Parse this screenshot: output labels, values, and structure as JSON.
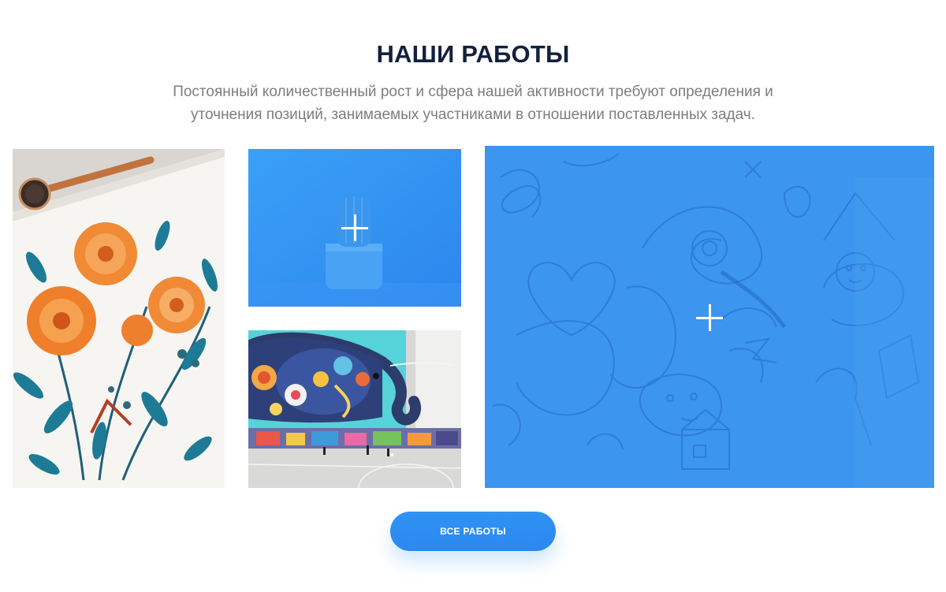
{
  "section": {
    "title": "НАШИ РАБОТЫ",
    "subtitle_line1": "Постоянный количественный рост и сфера нашей активности требуют определения и",
    "subtitle_line2": "уточнения позиций, занимаемых участниками в отношении поставленных задач."
  },
  "portfolio": {
    "items": [
      {
        "name": "watercolor-flowers",
        "overlay": false,
        "icon": "plus-icon"
      },
      {
        "name": "cactus-pot",
        "overlay": true,
        "icon": "plus-icon"
      },
      {
        "name": "elephant-mural",
        "overlay": false,
        "icon": "plus-icon"
      },
      {
        "name": "sketchbook-doodles",
        "overlay": true,
        "icon": "plus-icon"
      }
    ],
    "overlay_color": "#2f8ff0"
  },
  "button": {
    "all_works_label": "ВСЕ РАБОТЫ"
  },
  "colors": {
    "title": "#14213d",
    "subtitle": "#7d7d7d",
    "accent": "#2f93f3"
  }
}
